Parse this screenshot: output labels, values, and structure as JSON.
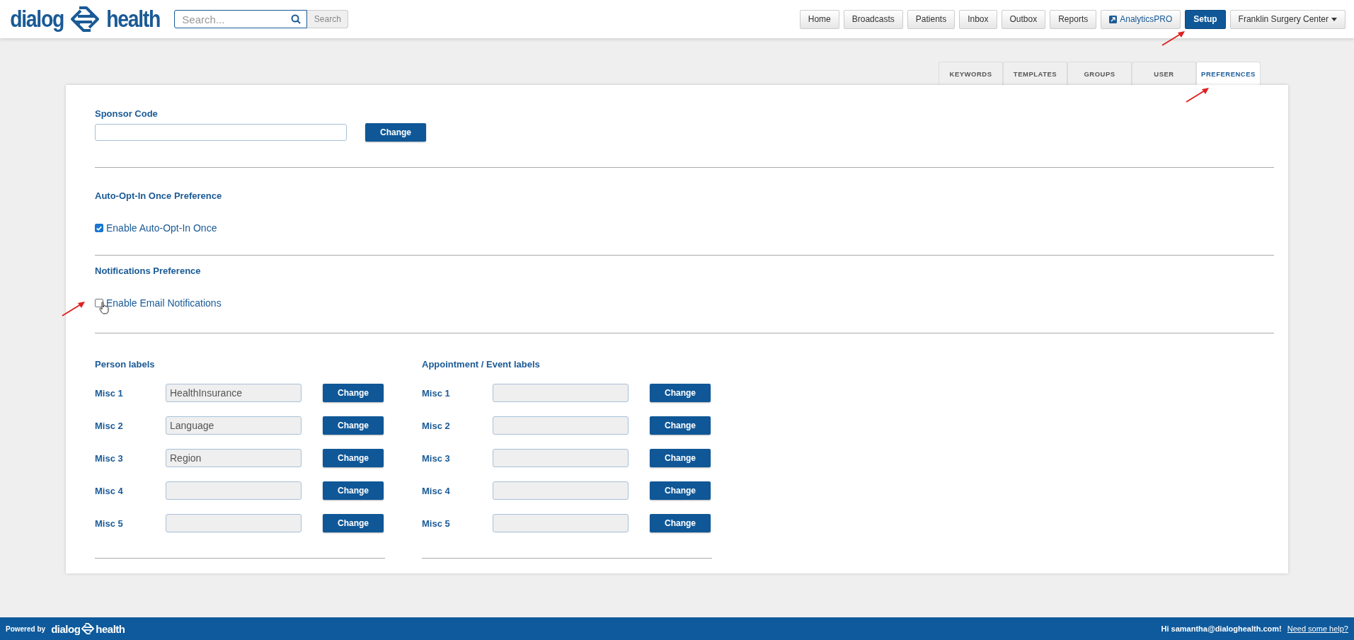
{
  "header": {
    "logo_left": "dialog",
    "logo_right": "health",
    "search": {
      "placeholder": "Search..."
    },
    "search_button": "Search",
    "nav": [
      {
        "label": "Home",
        "kind": "plain",
        "selected": false
      },
      {
        "label": "Broadcasts",
        "kind": "plain",
        "selected": false
      },
      {
        "label": "Patients",
        "kind": "plain",
        "selected": false
      },
      {
        "label": "Inbox",
        "kind": "plain",
        "selected": false
      },
      {
        "label": "Outbox",
        "kind": "plain",
        "selected": false
      },
      {
        "label": "Reports",
        "kind": "plain",
        "selected": false
      },
      {
        "label": "AnalyticsPRO",
        "kind": "external",
        "selected": false
      },
      {
        "label": "Setup",
        "kind": "plain",
        "selected": true
      },
      {
        "label": "Franklin Surgery Center",
        "kind": "dropdown",
        "selected": false
      }
    ]
  },
  "tabs": [
    {
      "label": "KEYWORDS",
      "selected": false
    },
    {
      "label": "TEMPLATES",
      "selected": false
    },
    {
      "label": "GROUPS",
      "selected": false
    },
    {
      "label": "USER",
      "selected": false
    },
    {
      "label": "PREFERENCES",
      "selected": true
    }
  ],
  "sponsor": {
    "title": "Sponsor Code",
    "button": "Change"
  },
  "auto_opt_in": {
    "title": "Auto-Opt-In Once Preference",
    "option": {
      "label": "Enable Auto-Opt-In Once",
      "checked": true
    }
  },
  "notifications": {
    "title": "Notifications Preference",
    "option": {
      "label": "Enable Email Notifications",
      "checked": false
    }
  },
  "label_groups": [
    {
      "title": "Person labels",
      "rows": [
        {
          "label": "Misc 1",
          "value": "HealthInsurance",
          "button": "Change"
        },
        {
          "label": "Misc 2",
          "value": "Language",
          "button": "Change"
        },
        {
          "label": "Misc 3",
          "value": "Region",
          "button": "Change"
        },
        {
          "label": "Misc 4",
          "button": "Change"
        },
        {
          "label": "Misc 5",
          "button": "Change"
        }
      ]
    },
    {
      "title": "Appointment / Event labels",
      "rows": [
        {
          "label": "Misc 1",
          "button": "Change"
        },
        {
          "label": "Misc 2",
          "button": "Change"
        },
        {
          "label": "Misc 3",
          "button": "Change"
        },
        {
          "label": "Misc 4",
          "button": "Change"
        },
        {
          "label": "Misc 5",
          "button": "Change"
        }
      ]
    }
  ],
  "footer": {
    "powered_by": "Powered by",
    "logo_left": "dialog",
    "logo_right": "health",
    "greeting": "Hi samantha@dialoghealth.com!",
    "help_link": "Need some help?"
  }
}
